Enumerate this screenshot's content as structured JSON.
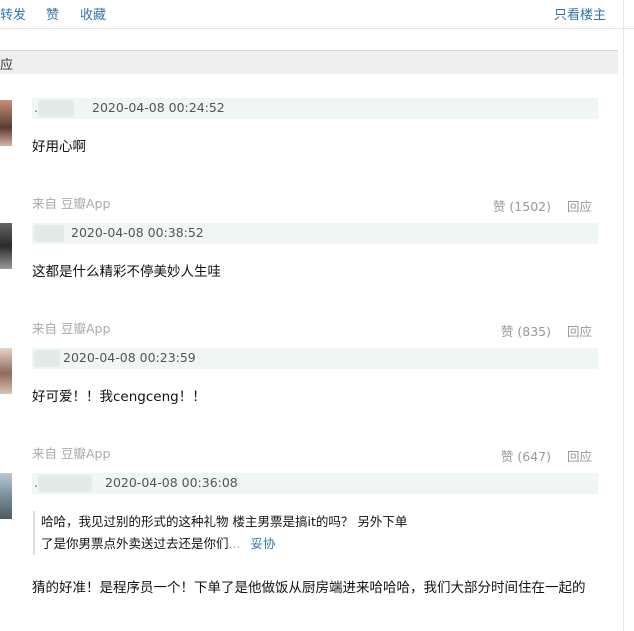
{
  "top_actions": {
    "repost": "转发",
    "like": "赞",
    "collect": "收藏",
    "only_op": "只看楼主"
  },
  "section_title": "回应",
  "comments": [
    {
      "user_dot": ".",
      "timestamp": "2020-04-08 00:24:52",
      "text": "好用心啊",
      "source": "来自 豆瓣App",
      "likes": "赞 (1502)",
      "reply": "回应"
    },
    {
      "timestamp": "2020-04-08 00:38:52",
      "text": "这都是什么精彩不停美妙人生哇",
      "source": "来自 豆瓣App",
      "likes": "赞 (835)",
      "reply": "回应"
    },
    {
      "timestamp": "2020-04-08 00:23:59",
      "text": "好可爱！！我cengceng！！",
      "source": "来自 豆瓣App",
      "likes": "赞 (647)",
      "reply": "回应"
    },
    {
      "user_dot": ".",
      "timestamp": "2020-04-08 00:36:08",
      "quote_line1": "哈哈，我见过别的形式的这种礼物 楼主男票是搞it的吗？ 另外下单",
      "quote_line2": "了是你男票点外卖送过去还是你们",
      "quote_more": "...",
      "quote_author": "妥协",
      "text": "猜的好准！是程序员一个！下单了是他做饭从厨房端进来哈哈哈，我们大部分时间住在一起的"
    }
  ]
}
